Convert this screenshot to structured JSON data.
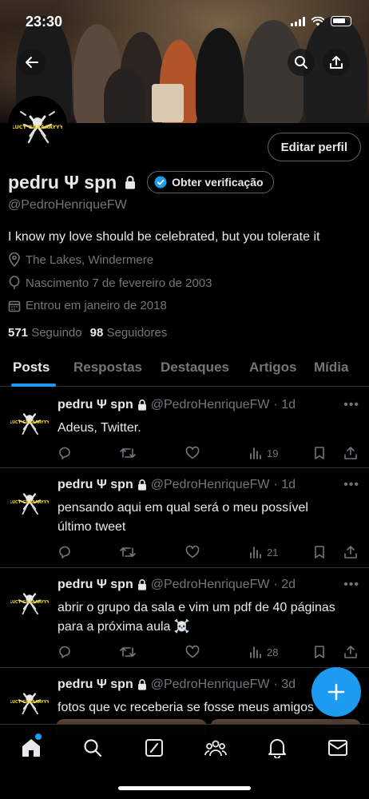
{
  "status_bar": {
    "time": "23:30"
  },
  "header": {
    "back_icon": "arrow-left-icon",
    "search_icon": "search-icon",
    "share_icon": "share-icon"
  },
  "profile": {
    "avatar_text": "LUCY GRAAAAYYY",
    "edit_label": "Editar perfil",
    "name": "pedru Ψ spn",
    "verify_label": "Obter verificação",
    "handle": "@PedroHenriqueFW",
    "bio": "I know my love should be celebrated, but you tolerate it",
    "location": "The Lakes, Windermere",
    "birthday": "Nascimento 7 de fevereiro de 2003",
    "joined": "Entrou em janeiro de 2018",
    "following_count": "571",
    "following_label": "Seguindo",
    "followers_count": "98",
    "followers_label": "Seguidores"
  },
  "tabs": [
    "Posts",
    "Respostas",
    "Destaques",
    "Artigos",
    "Mídia"
  ],
  "posts": [
    {
      "name": "pedru Ψ spn",
      "handle": "@PedroHenriqueFW",
      "time": "· 1d",
      "text": "Adeus, Twitter.",
      "views": "19"
    },
    {
      "name": "pedru Ψ spn",
      "handle": "@PedroHenriqueFW",
      "time": "· 1d",
      "text": "pensando aqui em qual será o meu possível último tweet",
      "views": "21"
    },
    {
      "name": "pedru Ψ spn",
      "handle": "@PedroHenriqueFW",
      "time": "· 2d",
      "text": "abrir o grupo da sala e vim um pdf de 40 páginas para a próxima aula ☠️",
      "views": "28"
    },
    {
      "name": "pedru Ψ spn",
      "handle": "@PedroHenriqueFW",
      "time": "· 3d",
      "text": "fotos que vc receberia se fosse meus amigos",
      "views": ""
    }
  ],
  "colors": {
    "accent": "#1d9bf0",
    "muted": "#71767b",
    "border": "#2f3336"
  }
}
